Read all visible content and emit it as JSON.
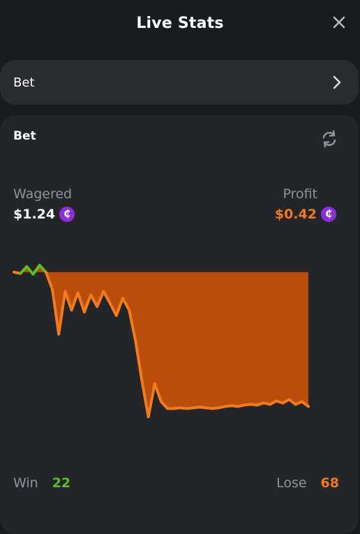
{
  "header": {
    "title": "Live Stats",
    "close_icon": "close-icon"
  },
  "selector": {
    "label": "Bet",
    "chevron_icon": "chevron-right-icon"
  },
  "card": {
    "title": "Bet",
    "refresh_icon": "refresh-icon",
    "wagered": {
      "label": "Wagered",
      "value": "$1.24",
      "coin": "₵"
    },
    "profit": {
      "label": "Profit",
      "value": "$0.42",
      "coin": "₵"
    },
    "win": {
      "label": "Win",
      "value": "22"
    },
    "lose": {
      "label": "Lose",
      "value": "68"
    }
  },
  "colors": {
    "win": "#5cbf1f",
    "lose": "#f47a1f",
    "fill": "#b84d0c",
    "coin": "#8a2fd9",
    "muted": "#8f9299"
  },
  "chart_data": {
    "type": "area",
    "x": [
      0,
      1,
      2,
      3,
      4,
      5,
      6,
      7,
      8,
      9,
      10,
      11,
      12,
      13,
      14,
      15,
      16,
      17,
      18,
      19,
      20,
      21,
      22,
      23,
      24,
      25,
      26,
      27,
      28,
      29,
      30,
      31,
      32,
      33,
      34,
      35,
      36,
      37,
      38,
      39,
      40,
      41,
      42,
      43,
      44,
      45,
      46
    ],
    "y": [
      0,
      -0.02,
      0.08,
      -0.03,
      0.1,
      0,
      -0.25,
      -0.9,
      -0.28,
      -0.55,
      -0.3,
      -0.58,
      -0.33,
      -0.5,
      -0.28,
      -0.45,
      -0.63,
      -0.38,
      -0.55,
      -1.0,
      -1.58,
      -2.1,
      -1.62,
      -1.88,
      -1.98,
      -1.98,
      -1.97,
      -1.98,
      -1.97,
      -1.96,
      -1.97,
      -1.98,
      -1.97,
      -1.95,
      -1.94,
      -1.95,
      -1.93,
      -1.92,
      -1.93,
      -1.9,
      -1.92,
      -1.87,
      -1.9,
      -1.85,
      -1.92,
      -1.88,
      -1.95
    ],
    "baseline": 0
  }
}
